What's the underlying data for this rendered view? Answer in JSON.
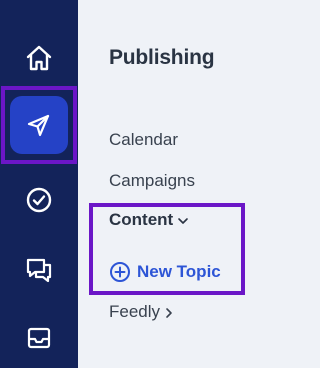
{
  "sidebar": {
    "icons": [
      {
        "name": "home-icon",
        "active": false
      },
      {
        "name": "send-icon",
        "active": true
      },
      {
        "name": "check-circle-icon",
        "active": false
      },
      {
        "name": "chat-icon",
        "active": false
      },
      {
        "name": "inbox-icon",
        "active": false
      }
    ]
  },
  "panel": {
    "title": "Publishing",
    "items": {
      "calendar": "Calendar",
      "campaigns": "Campaigns",
      "content": "Content",
      "new_topic": "New Topic",
      "feedly": "Feedly"
    }
  },
  "colors": {
    "rail_bg": "#13235a",
    "active_bg": "#2542c6",
    "highlight": "#6b16c7",
    "link": "#2d55d6",
    "panel_bg": "#eff2f7"
  }
}
